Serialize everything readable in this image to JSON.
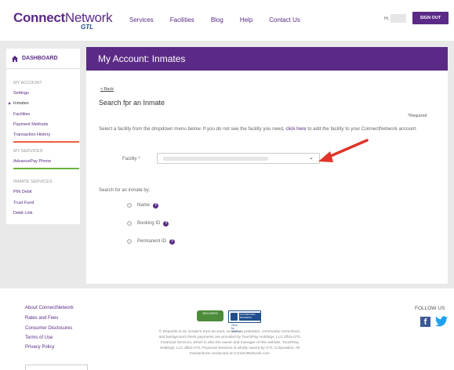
{
  "header": {
    "logo_main": "Connect",
    "logo_network": "Network",
    "logo_gtl": "GTL",
    "nav": [
      "Services",
      "Facilities",
      "Blog",
      "Help",
      "Contact Us"
    ],
    "greeting": "Hi,",
    "signout_label": "SIGN OUT"
  },
  "sidebar": {
    "dashboard_label": "DASHBOARD",
    "sections": {
      "my_account": "MY ACCOUNT",
      "my_services": "MY SERVICES",
      "inmate_services": "INMATE SERVICES"
    },
    "account_items": [
      "Settings",
      "Inmates",
      "Facilities",
      "Payment Methods",
      "Transaction History"
    ],
    "service_items": [
      "AdvancePay Phone"
    ],
    "inmate_service_items": [
      "PIN Debit",
      "Trust Fund",
      "Debit Link"
    ],
    "active_item": "Inmates",
    "colors": {
      "transaction_bar": "#e8613a",
      "advancepay_bar": "#6cb33f"
    }
  },
  "main": {
    "title": "My Account: Inmates",
    "back_link": "< Back",
    "search_title": "Search fpr an Inmate",
    "required_note": "*Required",
    "description_before": "Select a facility from the dropdown menu below. If you do not see the facility you need, ",
    "description_link": "click here",
    "description_after": " to add the facility to your ConnectNetwork account.",
    "facility_label": "Facility *",
    "search_by_label": "Search for an inmate by:",
    "options": [
      "Name",
      "Booking ID",
      "Permanent ID"
    ]
  },
  "footer": {
    "links": [
      "About ConnectNetwork",
      "Rates and Fees",
      "Consumer Disclosures",
      "Terms of Use",
      "Privacy Policy"
    ],
    "badge_secured": "SECURED",
    "badge_bbb": "ACCREDITED BUSINESS",
    "badge_bbb_caption": "Click for Review",
    "disclaimer": "© Deposits to an inmate's trust account, as well as probation, community corrections, and background check payments are provided by TouchPay Holdings, LLC d/b/a GTL Financial Services, which is also the owner and manager of this website. TouchPay Holdings, LLC d/b/a GTL Financial Services is wholly owned by GTL Corporation. All transactions conducted at ConnectNetwork.com",
    "follow_us": "FOLLOW US"
  },
  "colors": {
    "brand_purple": "#5b2a86",
    "arrow_red": "#e0352b",
    "background_band": "#e9e9e9"
  }
}
